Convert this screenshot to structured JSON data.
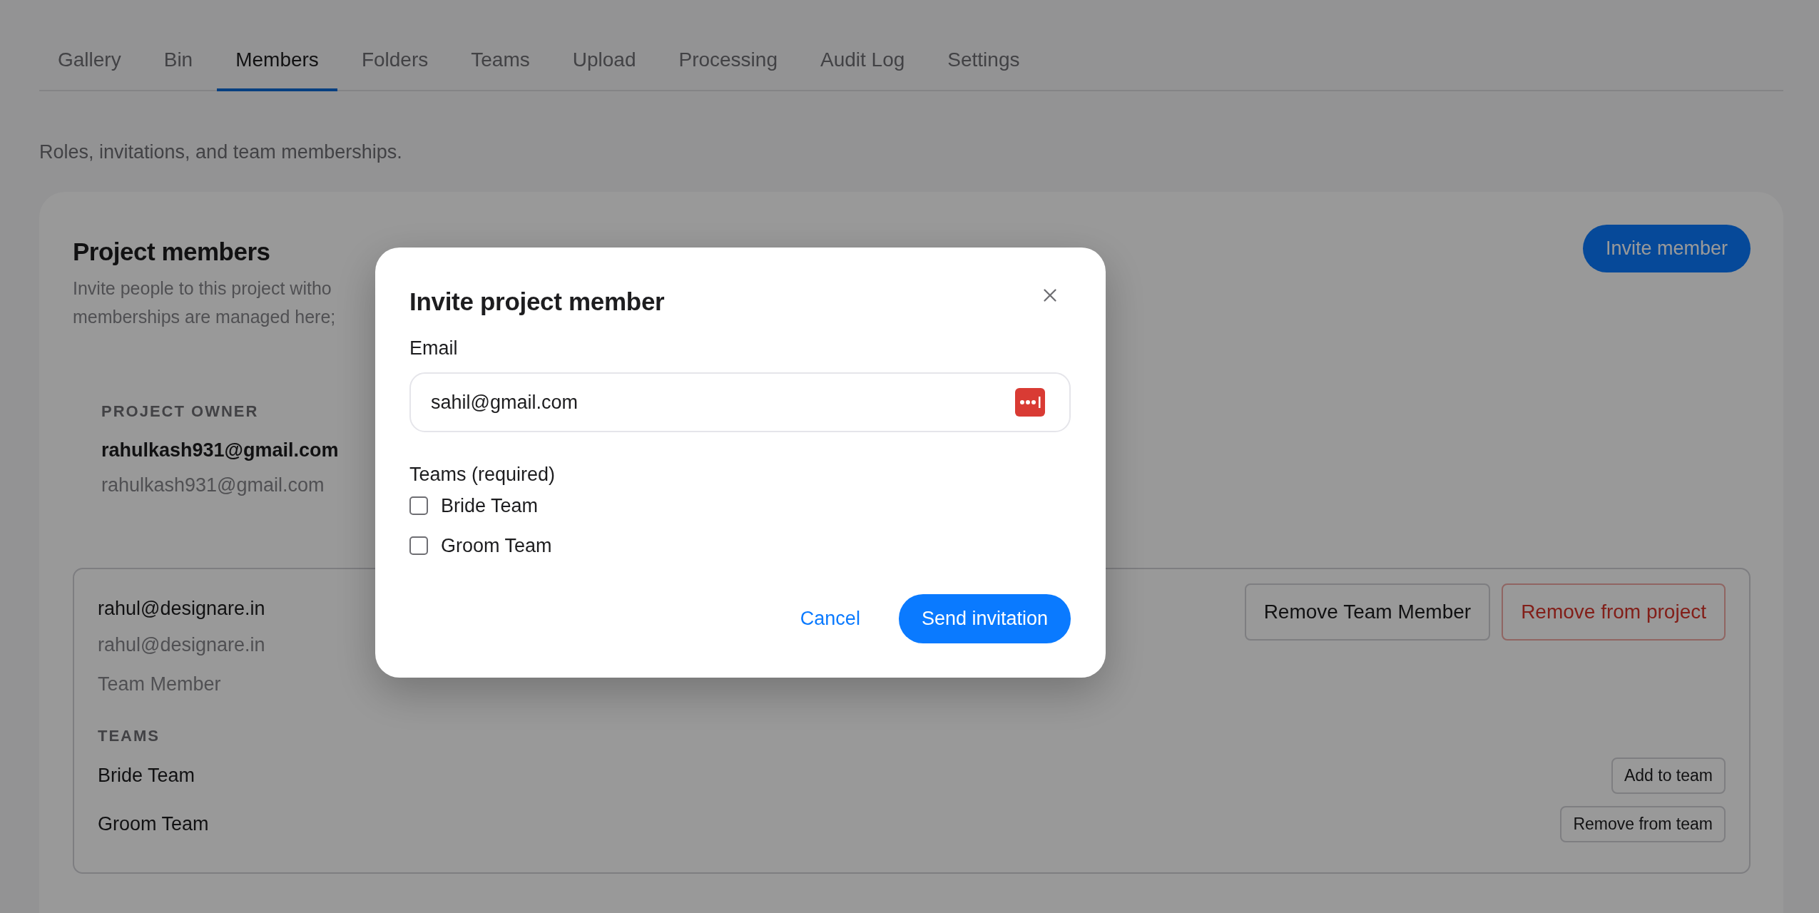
{
  "tabs": [
    {
      "label": "Gallery",
      "selected": false
    },
    {
      "label": "Bin",
      "selected": false
    },
    {
      "label": "Members",
      "selected": true
    },
    {
      "label": "Folders",
      "selected": false
    },
    {
      "label": "Teams",
      "selected": false
    },
    {
      "label": "Upload",
      "selected": false
    },
    {
      "label": "Processing",
      "selected": false
    },
    {
      "label": "Audit Log",
      "selected": false
    },
    {
      "label": "Settings",
      "selected": false
    }
  ],
  "subtitle": "Roles, invitations, and team memberships.",
  "project_members": {
    "title": "Project members",
    "invite_button": "Invite member",
    "description_lines": [
      "Invite people to this project witho",
      "memberships are managed here;"
    ],
    "owner": {
      "label": "PROJECT OWNER",
      "name": "rahulkash931@gmail.com",
      "email": "rahulkash931@gmail.com"
    },
    "members": [
      {
        "name": "rahul@designare.in",
        "email": "rahul@designare.in",
        "role": "Team Member",
        "actions": [
          {
            "label": "Remove Team Member",
            "kind": "neutral"
          },
          {
            "label": "Remove from project",
            "kind": "danger"
          }
        ],
        "teams_label": "TEAMS",
        "teams": [
          {
            "name": "Bride Team",
            "action": "Add to team"
          },
          {
            "name": "Groom Team",
            "action": "Remove from team"
          }
        ]
      }
    ]
  },
  "dialog": {
    "title": "Invite project member",
    "email_label": "Email",
    "email_value": "sahil@gmail.com",
    "teams_label": "Teams (required)",
    "teams": [
      {
        "label": "Bride Team",
        "checked": false
      },
      {
        "label": "Groom Team",
        "checked": false
      }
    ],
    "cancel": "Cancel",
    "submit": "Send invitation"
  }
}
